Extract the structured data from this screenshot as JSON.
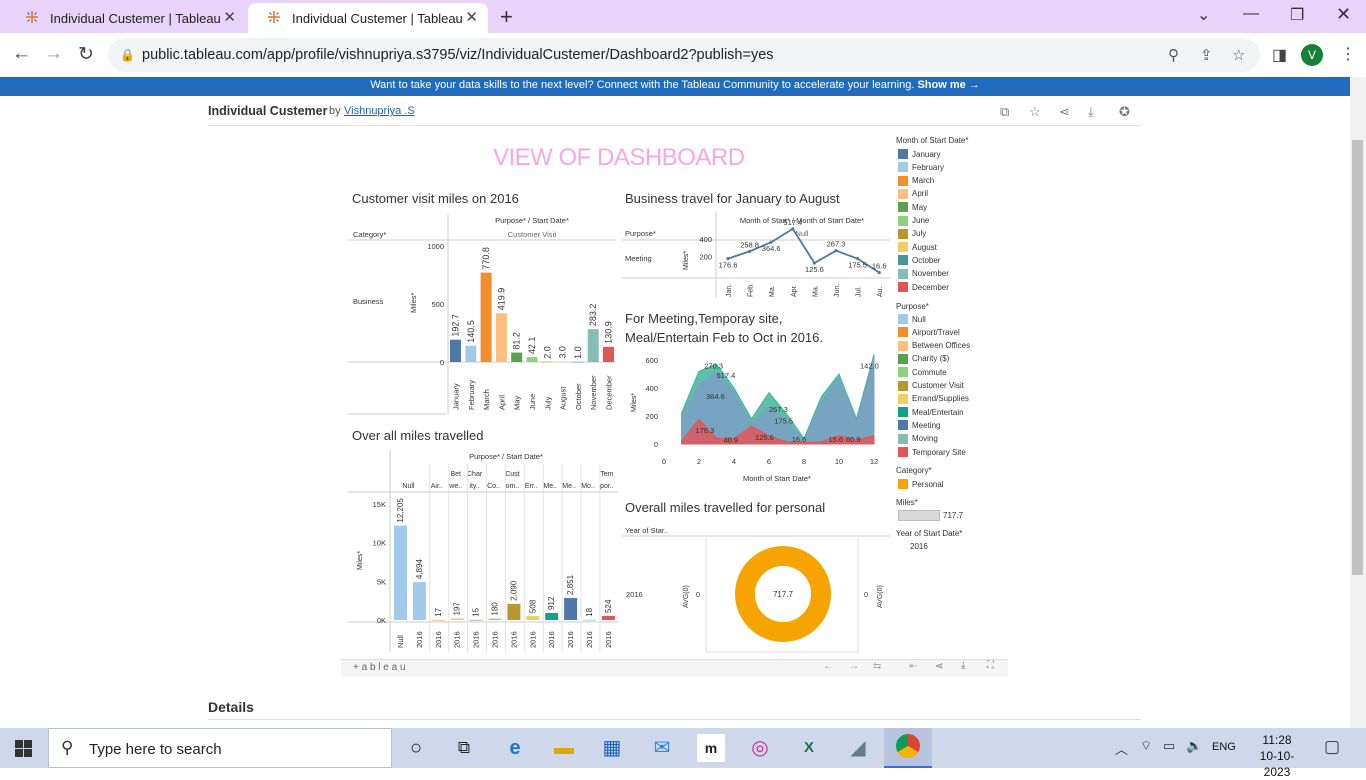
{
  "browser": {
    "tabs": [
      {
        "title": "Individual Custemer | Tableau Pu",
        "active": false
      },
      {
        "title": "Individual Custemer | Tableau Pu",
        "active": true
      }
    ],
    "url": "public.tableau.com/app/profile/vishnupriya.s3795/viz/IndividualCustemer/Dashboard2?publish=yes",
    "profile_initial": "V"
  },
  "banner": {
    "text": "Want to take your data skills to the next level? Connect with the Tableau Community to accelerate your learning.",
    "link": "Show me →"
  },
  "viz_header": {
    "title": "Individual Custemer",
    "by": "by",
    "author": "Vishnupriya .S"
  },
  "dashboard": {
    "title": "VIEW OF DASHBOARD"
  },
  "chart_titles": {
    "c1": "Customer visit miles on 2016",
    "c2": "Business travel for January to August",
    "c3a": "For Meeting,Temporay site,",
    "c3b": "Meal/Entertain Feb to Oct in 2016.",
    "c4": "Over all miles travelled",
    "c5": "Overall miles travelled for personal"
  },
  "chart_data": [
    {
      "type": "bar",
      "title": "Customer visit miles on 2016",
      "header": "Purpose* / Start Date*",
      "subheader": "Customer Visit",
      "row_header": "Category*",
      "row_label": "Business",
      "ylabel": "Miles*",
      "ylim": [
        0,
        1000
      ],
      "yticks": [
        "1000",
        "500",
        "0"
      ],
      "categories": [
        "January",
        "February",
        "March",
        "April",
        "May",
        "June",
        "July",
        "August",
        "October",
        "November",
        "December"
      ],
      "values": [
        192.7,
        140.5,
        770.8,
        419.9,
        81.2,
        42.1,
        2.0,
        3.0,
        1.0,
        283.2,
        130.9
      ],
      "labels": [
        "192.7",
        "140.5",
        "770.8",
        "419.9",
        "81.2",
        "42.1",
        "2.0",
        "3.0",
        "1.0",
        "283.2",
        "130.9"
      ],
      "colors": [
        "#4e79a7",
        "#a0cbe8",
        "#f28e2b",
        "#ffbe7d",
        "#59a14f",
        "#8cd17d",
        "#b6992d",
        "#f1ce63",
        "#499894",
        "#86bcb6",
        "#e15759"
      ]
    },
    {
      "type": "line",
      "title": "Business travel for January to August",
      "header": "Month of Start* / Month of Start Date*",
      "subheader": "Null",
      "row_header": "Purpose*",
      "row_label": "Meeting",
      "ylabel": "Miles*",
      "yticks": [
        "400",
        "200"
      ],
      "categories": [
        "Jan.",
        "Feb.",
        "Ma.",
        "Apr.",
        "Ma.",
        "Jun.",
        "Jul.",
        "Au."
      ],
      "values": [
        176.6,
        258.8,
        364.6,
        517.4,
        125.6,
        267.3,
        175.5,
        16.6
      ],
      "labels": [
        "176.6",
        "258.8",
        "364.6",
        "517.4",
        "125.6",
        "267.3",
        "175.5",
        "16.6"
      ]
    },
    {
      "type": "area",
      "title": "For Meeting,Temporay site, Meal/Entertain Feb to Oct in 2016.",
      "xlabel": "Month of Start Date*",
      "ylabel": "Miles*",
      "xticks": [
        "0",
        "2",
        "4",
        "6",
        "8",
        "10",
        "12"
      ],
      "yticks": [
        "600",
        "400",
        "200",
        "0"
      ],
      "xlim": [
        0,
        12
      ],
      "ylim": [
        0,
        600
      ],
      "x": [
        1,
        2,
        3,
        4,
        5,
        6,
        7,
        8,
        9,
        10,
        11,
        12
      ],
      "series": [
        {
          "name": "Temporary Site",
          "color": "#e15759",
          "values": [
            20,
            176.3,
            40.9,
            40,
            125.6,
            60,
            16.6,
            10,
            15.6,
            60.9,
            30,
            60
          ]
        },
        {
          "name": "Meeting",
          "color": "#7b9fc4",
          "values": [
            200,
            420,
            517.4,
            364.6,
            150,
            267.3,
            175.5,
            20,
            300,
            470,
            150,
            620
          ]
        },
        {
          "name": "Meal/Entertain",
          "color": "#41b499",
          "values": [
            220,
            520,
            570.3,
            400,
            180,
            367.3,
            215.5,
            40,
            340,
            500,
            180,
            640
          ]
        }
      ],
      "labels": [
        "270.3",
        "517.4",
        "364.6",
        "176.3",
        "40.9",
        "125.6",
        "267.3",
        "175.5",
        "16.6",
        "15.6",
        "60.9",
        "142.0"
      ]
    },
    {
      "type": "bar",
      "title": "Over all miles travelled",
      "header": "Purpose* / Start Date*",
      "col_groups": [
        "Null",
        "Air..",
        "Bet we..",
        "Char ity..",
        "Co..",
        "Cust om..",
        "Err..",
        "Me..",
        "Me..",
        "Mo..",
        "Tem por.."
      ],
      "ylabel": "Miles*",
      "yticks": [
        "15K",
        "10K",
        "5K",
        "0K"
      ],
      "ylim": [
        0,
        15000
      ],
      "categories": [
        "Null",
        "2016",
        "2016",
        "2016",
        "2016",
        "2016",
        "2016",
        "2016",
        "2016",
        "2016",
        "2016",
        "2016"
      ],
      "values": [
        12205,
        4894,
        17,
        197,
        15,
        180,
        2090,
        508,
        912,
        2851,
        18,
        524
      ],
      "labels": [
        "12,205",
        "4,894",
        "17",
        "197",
        "15",
        "180",
        "2,090",
        "508",
        "912",
        "2,851",
        "18",
        "524"
      ],
      "colors": [
        "#a0cbe8",
        "#a0cbe8",
        "#f28e2b",
        "#ffbe7d",
        "#59a14f",
        "#8cd17d",
        "#b6992d",
        "#f1ce63",
        "#16a085",
        "#4e79a7",
        "#86bcb6",
        "#e15759"
      ]
    },
    {
      "type": "pie",
      "title": "Overall miles travelled for personal",
      "row_header": "Year of Star..",
      "row_label": "2016",
      "left_axis": "AVG(0)",
      "right_axis": "AVG(0)",
      "axis_value": "0",
      "center_label": "717.7",
      "values": [
        717.7
      ],
      "color": "#f7a400"
    }
  ],
  "legend": {
    "month_title": "Month of Start Date*",
    "months": [
      {
        "label": "January",
        "color": "#4e79a7"
      },
      {
        "label": "February",
        "color": "#a0cbe8"
      },
      {
        "label": "March",
        "color": "#f28e2b"
      },
      {
        "label": "April",
        "color": "#ffbe7d"
      },
      {
        "label": "May",
        "color": "#59a14f"
      },
      {
        "label": "June",
        "color": "#8cd17d"
      },
      {
        "label": "July",
        "color": "#b6992d"
      },
      {
        "label": "August",
        "color": "#f1ce63"
      },
      {
        "label": "October",
        "color": "#499894"
      },
      {
        "label": "November",
        "color": "#86bcb6"
      },
      {
        "label": "December",
        "color": "#e15759"
      }
    ],
    "purpose_title": "Purpose*",
    "purposes": [
      {
        "label": "Null",
        "color": "#a0cbe8"
      },
      {
        "label": "Airport/Travel",
        "color": "#f28e2b"
      },
      {
        "label": "Between Offices",
        "color": "#ffbe7d"
      },
      {
        "label": "Charity ($)",
        "color": "#59a14f"
      },
      {
        "label": "Commute",
        "color": "#8cd17d"
      },
      {
        "label": "Customer Visit",
        "color": "#b6992d"
      },
      {
        "label": "Errand/Supplies",
        "color": "#f1ce63"
      },
      {
        "label": "Meal/Entertain",
        "color": "#16a085"
      },
      {
        "label": "Meeting",
        "color": "#4e79a7"
      },
      {
        "label": "Moving",
        "color": "#86bcb6"
      },
      {
        "label": "Temporary Site",
        "color": "#e15759"
      }
    ],
    "category_title": "Category*",
    "category": {
      "label": "Personal",
      "color": "#f7a400"
    },
    "miles_title": "Miles*",
    "miles_value": "717.7",
    "year_title": "Year of Start Date*",
    "year_value": "2016"
  },
  "tableau_logo": "+ a b l e a u",
  "details": "Details",
  "taskbar": {
    "search_placeholder": "Type here to search",
    "lang": "ENG",
    "time": "11:28",
    "date": "10-10-2023"
  }
}
